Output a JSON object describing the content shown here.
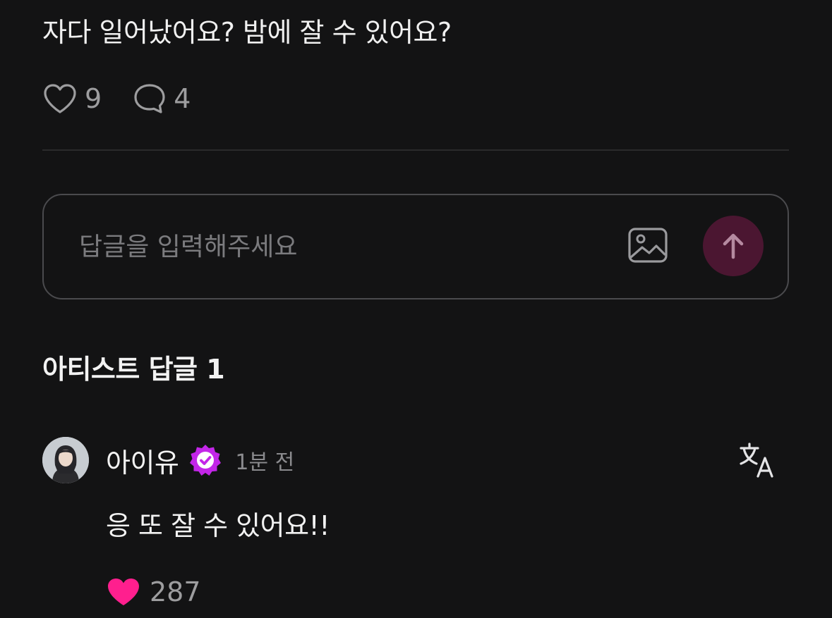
{
  "post": {
    "text": "자다 일어났어요? 밤에 잘 수 있어요?",
    "likes": "9",
    "comments": "4"
  },
  "reply_input": {
    "placeholder": "답글을 입력해주세요"
  },
  "artist_replies": {
    "title": "아티스트 답글 1",
    "items": [
      {
        "author": "아이유",
        "time": "1분 전",
        "text": "응 또 잘 수 있어요!!",
        "likes": "287"
      }
    ]
  },
  "icons": {
    "like": "heart-outline-icon",
    "comment": "speech-bubble-icon",
    "image": "image-icon",
    "send": "arrow-up-icon",
    "verified": "verified-badge-icon",
    "translate": "translate-icon",
    "liked": "heart-filled-icon"
  },
  "colors": {
    "background": "#131314",
    "send_button": "#4b1631",
    "verified_badge": "#c326e8",
    "liked_heart": "#ff1f8e",
    "muted_text": "#9d9d9f"
  }
}
